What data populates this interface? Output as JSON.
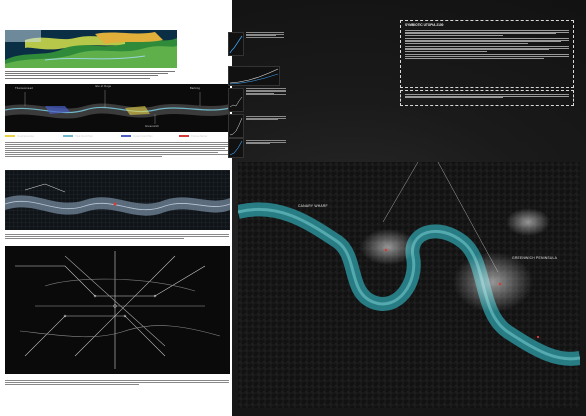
{
  "map_labels": {
    "canary_wharf": "CANARY WHARF",
    "greenwich": "GREENWICH PENINSULA"
  },
  "flood_legend": [
    {
      "label": "Flood Extensive",
      "color": "#e9d34a"
    },
    {
      "label": "Tidal Flood Plain",
      "color": "#6fb7c9"
    },
    {
      "label": "Fluvial Flood Plain",
      "color": "#4a5fc9"
    },
    {
      "label": "Thames Barrier",
      "color": "#d43b3b"
    }
  ],
  "thames_labels": {
    "a": "Thamesmead",
    "b": "Isle of Dogs",
    "c": "Greenwich",
    "d": "Barking"
  },
  "utopia_title": "SYMBIOTIC UTOPIA 2100",
  "colors": {
    "background": "#151515",
    "river": "#3fa9b0",
    "river_glow": "#7fd6da",
    "highlight_red": "#d43b3b"
  }
}
